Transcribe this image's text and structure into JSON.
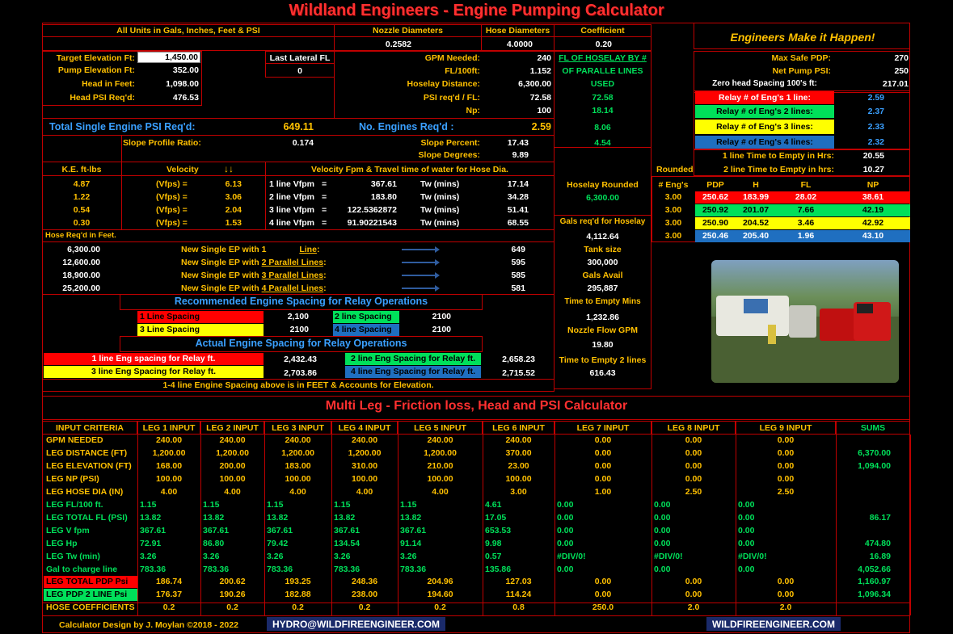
{
  "title": "Wildland Engineers  -  Engine Pumping Calculator",
  "units_note": "All Units in Gals, Inches, Feet & PSI",
  "nozzle": {
    "label": "Nozzle Diameters",
    "value": "0.2582"
  },
  "hose": {
    "label": "Hose Diameters",
    "value": "4.0000"
  },
  "coef": {
    "label": "Coefficient",
    "value": "0.20"
  },
  "slogan": "Engineers Make it Happen!",
  "inputs": [
    {
      "label": "Target Elevation Ft:",
      "value": "1,450.00"
    },
    {
      "label": "Pump Elevation Ft:",
      "value": "352.00"
    },
    {
      "label": "Head in Feet:",
      "value": "1,098.00"
    },
    {
      "label": "Head PSI Req'd:",
      "value": "476.53"
    }
  ],
  "last_lateral": {
    "label": "Last Lateral FL",
    "value": "0"
  },
  "mid": [
    {
      "label": "GPM Needed:",
      "value": "240"
    },
    {
      "label": "FL/100ft:",
      "value": "1.152"
    },
    {
      "label": "Hoselay Distance:",
      "value": "6,300.00"
    },
    {
      "label": "PSI req'd / FL:",
      "value": "72.58"
    },
    {
      "label": "Np:",
      "value": "100"
    }
  ],
  "fl_hoselay": {
    "l1": "FL OF HOSELAY BY #",
    "l2": "OF PARALLE LINES",
    "l3": "USED",
    "v": [
      "72.58",
      "18.14",
      "8.06",
      "4.54"
    ]
  },
  "right_top": [
    {
      "label": "Max Safe PDP:",
      "value": "270"
    },
    {
      "label": "Net Pump PSI:",
      "value": "250"
    },
    {
      "label": "Zero head Spacing 100's ft:",
      "value": "217.01"
    }
  ],
  "relay": [
    {
      "label": "Relay # of Eng's 1  line:",
      "value": "2.59",
      "color": "#ff0000"
    },
    {
      "label": "Relay # of Eng's 2 lines:",
      "value": "2.37",
      "color": "#00e05a"
    },
    {
      "label": "Relay # of Eng's 3 lines:",
      "value": "2.33",
      "color": "#ffff00"
    },
    {
      "label": "Relay # of Eng's 4 lines:",
      "value": "2.32",
      "color": "#1f6fc0"
    }
  ],
  "time_empty": [
    {
      "label": "1 line Time to Empty in Hrs:",
      "value": "20.55"
    },
    {
      "label": "2 line Time to Empty in hrs:",
      "value": "10.27"
    }
  ],
  "rounded_label": "Rounded",
  "total_single": {
    "label": "Total Single Engine PSI Req'd:",
    "value": "649.11"
  },
  "engines_req": {
    "label": "No. Engines Req'd :",
    "value": "2.59"
  },
  "slope": {
    "ratio_label": "Slope Profile Ratio:",
    "ratio": "0.174",
    "pct_label": "Slope Percent:",
    "pct": "17.43",
    "deg_label": "Slope Degrees:",
    "deg": "9.89"
  },
  "velocity_head": {
    "ke": "K.E. ft-lbs",
    "vel": "Velocity",
    "arrows": "↓↓",
    "title": "Velocity Fpm & Travel time of water for Hose Dia."
  },
  "velocity_rows": [
    {
      "ke": "4.87",
      "unit": "(Vfps) =",
      "v": "6.13",
      "line": "1 line Vfpm",
      "eq": "=",
      "fpm": "367.61",
      "tw": "Tw (mins)",
      "min": "17.14"
    },
    {
      "ke": "1.22",
      "unit": "(Vfps) =",
      "v": "3.06",
      "line": "2 line Vfpm",
      "eq": "=",
      "fpm": "183.80",
      "tw": "Tw (mins)",
      "min": "34.28"
    },
    {
      "ke": "0.54",
      "unit": "(Vfps) =",
      "v": "2.04",
      "line": "3 line Vfpm",
      "eq": "=",
      "fpm": "122.5362872",
      "tw": "Tw (mins)",
      "min": "51.41"
    },
    {
      "ke": "0.30",
      "unit": "(Vfps) =",
      "v": "1.53",
      "line": "4 line Vfpm",
      "eq": "=",
      "fpm": "91.90221543",
      "tw": "Tw (mins)",
      "min": "68.55"
    }
  ],
  "hoselay_rounded": {
    "label": "Hoselay Rounded",
    "value": "6,300.00"
  },
  "gals_req": {
    "label": "Gals req'd for Hoselay",
    "value": "4,112.64"
  },
  "tank": {
    "label": "Tank size",
    "value": "300,000"
  },
  "gals_avail": {
    "label": "Gals Avail",
    "value": "295,887"
  },
  "time_empty_mins": {
    "label": "Time to Empty Mins",
    "value": "1,232.86"
  },
  "nozzle_flow": {
    "label": "Nozzle Flow GPM",
    "value": "19.80"
  },
  "time_empty_2": {
    "label": "Time to Empty 2 lines",
    "value": "616.43"
  },
  "eng_table": {
    "headers": [
      "# Eng's",
      "PDP",
      "H",
      "FL",
      "NP"
    ],
    "rows": [
      {
        "n": "3.00",
        "pdp": "250.62",
        "h": "183.99",
        "fl": "28.02",
        "np": "38.61",
        "color": "#ff0000"
      },
      {
        "n": "3.00",
        "pdp": "250.92",
        "h": "201.07",
        "fl": "7.66",
        "np": "42.19",
        "color": "#00e05a"
      },
      {
        "n": "3.00",
        "pdp": "250.90",
        "h": "204.52",
        "fl": "3.46",
        "np": "42.92",
        "color": "#ffff00"
      },
      {
        "n": "3.00",
        "pdp": "250.46",
        "h": "205.40",
        "fl": "1.96",
        "np": "43.10",
        "color": "#1f6fc0"
      }
    ]
  },
  "hose_req_label": "Hose Req'd in Feet.",
  "new_ep": [
    {
      "feet": "6,300.00",
      "pre": "New Single EP with 1",
      "link": "Line",
      "post": ":",
      "value": "649"
    },
    {
      "feet": "12,600.00",
      "pre": "New Single EP with",
      "link": "2 Parallel Lines",
      "post": ":",
      "value": "595"
    },
    {
      "feet": "18,900.00",
      "pre": "New Single EP with",
      "link": "3 Parallel Lines",
      "post": ":",
      "value": "585"
    },
    {
      "feet": "25,200.00",
      "pre": "New Single EP with",
      "link": "4 Parallel Lines",
      "post": ":",
      "value": "581"
    }
  ],
  "recommended": {
    "title": "Recommended Engine Spacing for Relay Operations",
    "l1": "1 Line Spacing",
    "v1": "2,100",
    "l2": "2 line Spacing",
    "v2": "2100",
    "l3": "3 Line Spacing",
    "v3": "2100",
    "l4": "4 line Spacing",
    "v4": "2100"
  },
  "actual": {
    "title": "Actual Engine Spacing for Relay Operations",
    "l1": "1 line Eng spacing for  Relay ft.",
    "v1": "2,432.43",
    "l2": "2 line Eng Spacing for Relay ft.",
    "v2": "2,658.23",
    "l3": "3 line Eng Spacing for Relay ft.",
    "v3": "2,703.86",
    "l4": "4 line Eng Spacing for Relay ft.",
    "v4": "2,715.52",
    "note": "1-4 line Engine Spacing above is in FEET & Accounts for Elevation."
  },
  "multi": {
    "title": "Multi Leg - Friction loss, Head and PSI Calculator",
    "headers": [
      "INPUT CRITERIA",
      "LEG 1 INPUT",
      "LEG 2 INPUT",
      "LEG 3 INPUT",
      "LEG 4 INPUT",
      "LEG 5 INPUT",
      "LEG 6 INPUT",
      "LEG 7 INPUT",
      "LEG 8 INPUT",
      "LEG 9 INPUT",
      "SUMS"
    ],
    "rows": [
      {
        "label": "GPM NEEDED",
        "vals": [
          "240.00",
          "240.00",
          "240.00",
          "240.00",
          "240.00",
          "240.00",
          "0.00",
          "0.00",
          "0.00"
        ],
        "sum": "",
        "lc": "or",
        "vc": "or"
      },
      {
        "label": "LEG DISTANCE (FT)",
        "vals": [
          "1,200.00",
          "1,200.00",
          "1,200.00",
          "1,200.00",
          "1,200.00",
          "370.00",
          "0.00",
          "0.00",
          "0.00"
        ],
        "sum": "6,370.00",
        "lc": "or",
        "vc": "or"
      },
      {
        "label": "LEG ELEVATION (FT)",
        "vals": [
          "168.00",
          "200.00",
          "183.00",
          "310.00",
          "210.00",
          "23.00",
          "0.00",
          "0.00",
          "0.00"
        ],
        "sum": "1,094.00",
        "lc": "or",
        "vc": "or"
      },
      {
        "label": "LEG NP (PSI)",
        "vals": [
          "100.00",
          "100.00",
          "100.00",
          "100.00",
          "100.00",
          "100.00",
          "0.00",
          "0.00",
          "0.00"
        ],
        "sum": "",
        "lc": "or",
        "vc": "or"
      },
      {
        "label": "LEG HOSE DIA (IN)",
        "vals": [
          "4.00",
          "4.00",
          "4.00",
          "4.00",
          "4.00",
          "3.00",
          "1.00",
          "2.50",
          "2.50"
        ],
        "sum": "",
        "lc": "or",
        "vc": "or"
      },
      {
        "label": "LEG FL/100 ft.",
        "vals": [
          "1.15",
          "1.15",
          "1.15",
          "1.15",
          "1.15",
          "4.61",
          "0.00",
          "0.00",
          "0.00"
        ],
        "sum": "",
        "lc": "gr",
        "vc": "gr"
      },
      {
        "label": "LEG TOTAL FL (PSI)",
        "vals": [
          "13.82",
          "13.82",
          "13.82",
          "13.82",
          "13.82",
          "17.05",
          "0.00",
          "0.00",
          "0.00"
        ],
        "sum": "86.17",
        "lc": "gr",
        "vc": "gr"
      },
      {
        "label": "LEG V fpm",
        "vals": [
          "367.61",
          "367.61",
          "367.61",
          "367.61",
          "367.61",
          "653.53",
          "0.00",
          "0.00",
          "0.00"
        ],
        "sum": "",
        "lc": "gr",
        "vc": "gr"
      },
      {
        "label": "LEG Hp",
        "vals": [
          "72.91",
          "86.80",
          "79.42",
          "134.54",
          "91.14",
          "9.98",
          "0.00",
          "0.00",
          "0.00"
        ],
        "sum": "474.80",
        "lc": "gr",
        "vc": "gr"
      },
      {
        "label": "LEG Tw (min)",
        "vals": [
          "3.26",
          "3.26",
          "3.26",
          "3.26",
          "3.26",
          "0.57",
          "#DIV/0!",
          "#DIV/0!",
          "#DIV/0!"
        ],
        "sum": "16.89",
        "lc": "gr",
        "vc": "gr"
      },
      {
        "label": "Gal to charge line",
        "vals": [
          "783.36",
          "783.36",
          "783.36",
          "783.36",
          "783.36",
          "135.86",
          "0.00",
          "0.00",
          "0.00"
        ],
        "sum": "4,052.66",
        "lc": "gr",
        "vc": "gr"
      },
      {
        "label": "LEG TOTAL PDP Psi",
        "vals": [
          "186.74",
          "200.62",
          "193.25",
          "248.36",
          "204.96",
          "127.03",
          "0.00",
          "0.00",
          "0.00"
        ],
        "sum": "1,160.97",
        "lc": "redbg",
        "vc": "or"
      },
      {
        "label": "LEG PDP 2 LINE Psi",
        "vals": [
          "176.37",
          "190.26",
          "182.88",
          "238.00",
          "194.60",
          "114.24",
          "0.00",
          "0.00",
          "0.00"
        ],
        "sum": "1,096.34",
        "lc": "grbg",
        "vc": "or"
      },
      {
        "label": "HOSE COEFFICIENTS",
        "vals": [
          "0.2",
          "0.2",
          "0.2",
          "0.2",
          "0.2",
          "0.8",
          "250.0",
          "2.0",
          "2.0"
        ],
        "sum": "",
        "lc": "or",
        "vc": "or"
      }
    ]
  },
  "footer": {
    "credit": "Calculator Design by J. Moylan ©2018 - 2022",
    "email": "HYDRO@WILDFIREENGINEER.COM",
    "site": "WILDFIREENGINEER.COM"
  }
}
